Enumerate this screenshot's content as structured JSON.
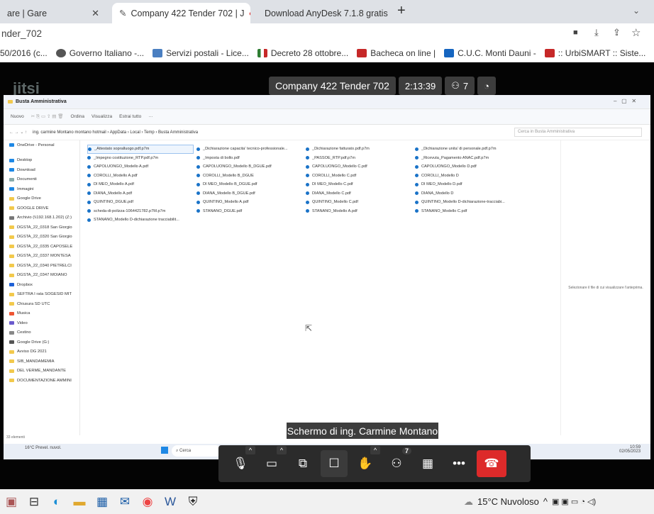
{
  "browser": {
    "tabs": [
      {
        "label": "are | Gare"
      },
      {
        "label": "Company 422 Tender 702 | J"
      },
      {
        "label": "Download AnyDesk 7.1.8 gratis"
      }
    ],
    "new_tab": "+",
    "address": "nder_702",
    "bookmarks": [
      "50/2016 (c...",
      "Governo Italiano -...",
      "Servizi postali - Lice...",
      "Decreto 28 ottobre...",
      "Bacheca on line |",
      "C.U.C. Monti Dauni -",
      ":: UrbiSMART :: Siste..."
    ]
  },
  "meeting": {
    "logo": "jitsi",
    "title": "Company 422 Tender 702",
    "timer": "2:13:39",
    "participants": "7",
    "share_label": "Schermo di ing. Carmine Montano",
    "toolbar_badge": "7"
  },
  "remote": {
    "window_title": "Busta Amministrativa",
    "commands": [
      "Nuovo",
      "Ordina",
      "Visualizza",
      "Estrai tutto",
      "···"
    ],
    "path": "ing. carmine Montano montano hotmail › AppData › Local › Temp › Busta Amministrativa",
    "search_placeholder": "Cerca in Busta Amministrativa",
    "sidebar": [
      "OneDrive - Personal",
      "Desktop",
      "Download",
      "Documenti",
      "Immagini",
      "Google Drive",
      "GOOGLE DRIVE",
      "Archivio (\\\\192.168.1.202) (Z:)",
      "DGSTA_22_0318 San Giorgio",
      "DGSTA_22_0320 San Giorgio",
      "DGSTA_22_0335 CAPOSELE",
      "DGSTA_22_0337 MONTESA",
      "DGSTA_22_0340 PIETRELCI",
      "DGSTA_22_0347 MOIANO",
      "Dropbox",
      "SEFTRA I rata SOGESID MIT",
      "Chiusura SD UTC",
      "Musica",
      "Video",
      "Cestino",
      "Google Drive (G:)",
      "Avviso DG 2021",
      "SIB_MANDAMEMIA",
      "DEL VERME_MANDANTE",
      "DOCUMENTAZIONE AMMINI"
    ],
    "columns": [
      [
        "_Attestato sopralluogo.pdf.p7m",
        "_Impegno costituzione_RTP.pdf.p7m",
        "CAPOLUONGO_Modello A.pdf",
        "COROLLI_Modello A.pdf",
        "DI MEO_Modello A.pdf",
        "DIANA_Modello A.pdf",
        "QUINTINO_DGUE.pdf",
        "scheda-di-polizza-1064421782.p7M.p7m",
        "STANANO_Modello D-dichiarazione tracciabilit..."
      ],
      [
        "_Dichiarazione capacita' tecnico-professionale...",
        "_Imposta di bollo.pdf",
        "CAPOLUONGO_Modello B_DGUE.pdf",
        "COROLLI_Modello B_DGUE",
        "DI MEO_Modello B_DGUE.pdf",
        "DIANA_Modello B_DGUE.pdf",
        "QUINTINO_Modello A.pdf",
        "STANANO_DGUE.pdf"
      ],
      [
        "_Dichiarazione fatturato.pdf.p7m",
        "_PASSOE_RTP.pdf.p7m",
        "CAPOLUONGO_Modello C.pdf",
        "COROLLI_Modello C.pdf",
        "DI MEO_Modello C.pdf",
        "DIANA_Modello C.pdf",
        "QUINTINO_Modello C.pdf",
        "STANANO_Modello A.pdf"
      ],
      [
        "_Dichiarazione unita' di personale.pdf.p7m",
        "_Ricevuta_Pagamento ANAC.pdf.p7m",
        "CAPOLUONGO_Modello D.pdf",
        "COROLLI_Modello D",
        "DI MEO_Modello D.pdf",
        "DIANA_Modello D",
        "QUINTINO_Modello D-dichiarazione-tracciabi...",
        "STANANO_Modello C.pdf"
      ]
    ],
    "preview_text": "Selezionare il file di cui visualizzare l'anteprima.",
    "status": "33 elementi",
    "weather_small": "16°C Prevel. nuvol.",
    "taskbar_search": "Cerca",
    "clock_time": "10:59",
    "clock_date": "02/05/2023"
  },
  "taskbar": {
    "weather": "15°C Nuvoloso"
  }
}
